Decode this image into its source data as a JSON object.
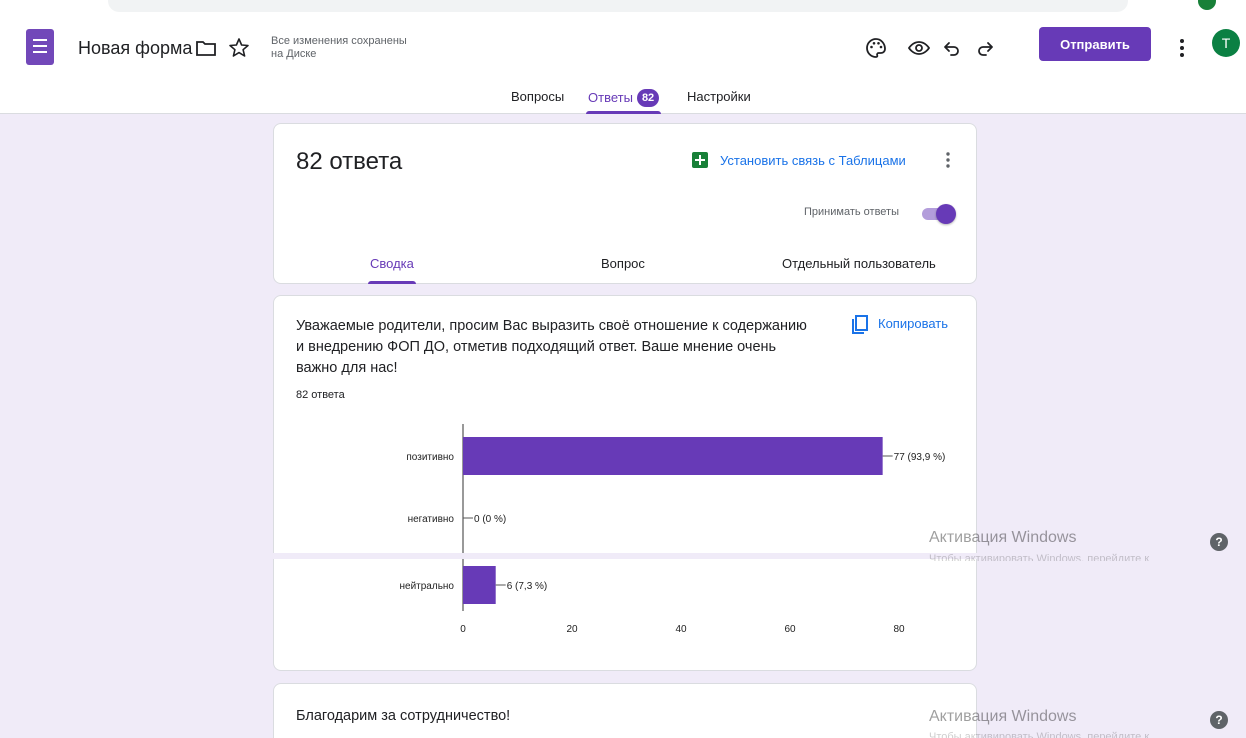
{
  "app": {
    "form_title": "Новая форма",
    "save_status_line1": "Все изменения сохранены",
    "save_status_line2": "на Диске",
    "send_label": "Отправить",
    "avatar_letter": "Т",
    "brand_color": "#673ab7"
  },
  "tabs": {
    "questions": "Вопросы",
    "responses": "Ответы",
    "responses_count": "82",
    "settings": "Настройки"
  },
  "summary_card": {
    "title": "82 ответа",
    "sheets_link": "Установить связь с Таблицами",
    "accept_label": "Принимать ответы",
    "accepting": true,
    "subtabs": [
      "Сводка",
      "Вопрос",
      "Отдельный пользователь"
    ]
  },
  "question_card": {
    "title": "Уважаемые родители, просим Вас выразить своё отношение к содержанию и внедрению ФОП ДО, отметив подходящий ответ. Ваше мнение очень важно для нас!",
    "count": "82 ответа",
    "copy_label": "Копировать"
  },
  "chart_data": {
    "type": "bar",
    "orientation": "horizontal",
    "categories": [
      "позитивно",
      "негативно",
      "нейтрально"
    ],
    "values": [
      77,
      0,
      6
    ],
    "data_labels": [
      "77 (93,9 %)",
      "0 (0 %)",
      "6 (7,3 %)"
    ],
    "xlim": [
      0,
      80
    ],
    "xticks": [
      "0",
      "20",
      "40",
      "60",
      "80"
    ],
    "bar_color": "#673ab7"
  },
  "thanks_card": {
    "text": "Благодарим за сотрудничество!"
  },
  "watermark": {
    "title": "Активация Windows",
    "subtitle": "Чтобы активировать Windows, перейдите к"
  }
}
